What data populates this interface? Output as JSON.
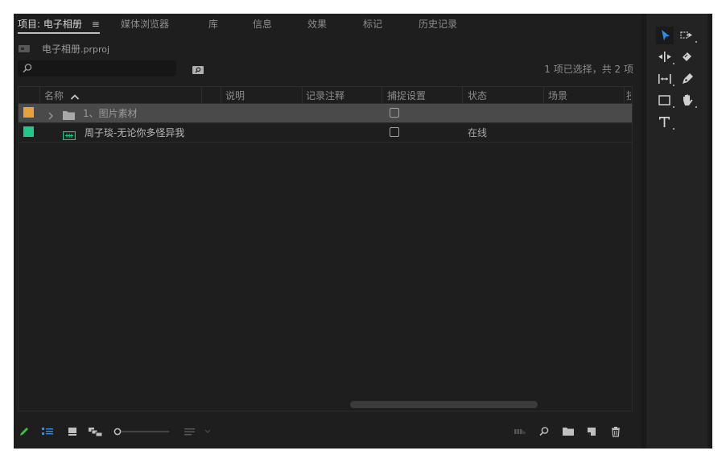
{
  "tabs": [
    {
      "label": "项目: 电子相册",
      "active": true
    },
    {
      "label": "媒体浏览器",
      "active": false
    },
    {
      "label": "库",
      "active": false
    },
    {
      "label": "信息",
      "active": false
    },
    {
      "label": "效果",
      "active": false
    },
    {
      "label": "标记",
      "active": false
    },
    {
      "label": "历史记录",
      "active": false
    }
  ],
  "tab_menu_icon": "≡",
  "project": {
    "name": "电子相册",
    "ext": ".prproj"
  },
  "search": {
    "value": "",
    "placeholder": ""
  },
  "selection_status": "1 项已选择，共 2 项",
  "columns": [
    "名称",
    "说明",
    "记录注释",
    "捕捉设置",
    "状态",
    "场景",
    "技"
  ],
  "rows": [
    {
      "color": "#e8a23b",
      "type": "bin",
      "name": "1、图片素材",
      "capture_checked": false,
      "status": "",
      "selected": true
    },
    {
      "color": "#22c88a",
      "type": "sequence",
      "name": "周子琰-无论你多怪异我",
      "capture_checked": false,
      "status": "在线",
      "selected": false
    }
  ],
  "footer_icons": [
    "pencil-icon",
    "list-view-icon",
    "icon-view-icon",
    "freeform-view-icon",
    "zoom-slider",
    "sort-icon",
    "automate-icon",
    "find-icon",
    "new-bin-icon",
    "new-item-icon",
    "clear-icon"
  ],
  "tools": [
    "selection-tool",
    "track-select-tool",
    "ripple-edit-tool",
    "razor-tool",
    "slip-tool",
    "pen-tool",
    "rectangle-tool",
    "hand-tool",
    "type-tool"
  ],
  "colors": {
    "accent": "#2d8ceb",
    "bin_label": "#e8a23b",
    "sequence_label": "#22c88a",
    "panel_bg": "#1e1e1e"
  }
}
